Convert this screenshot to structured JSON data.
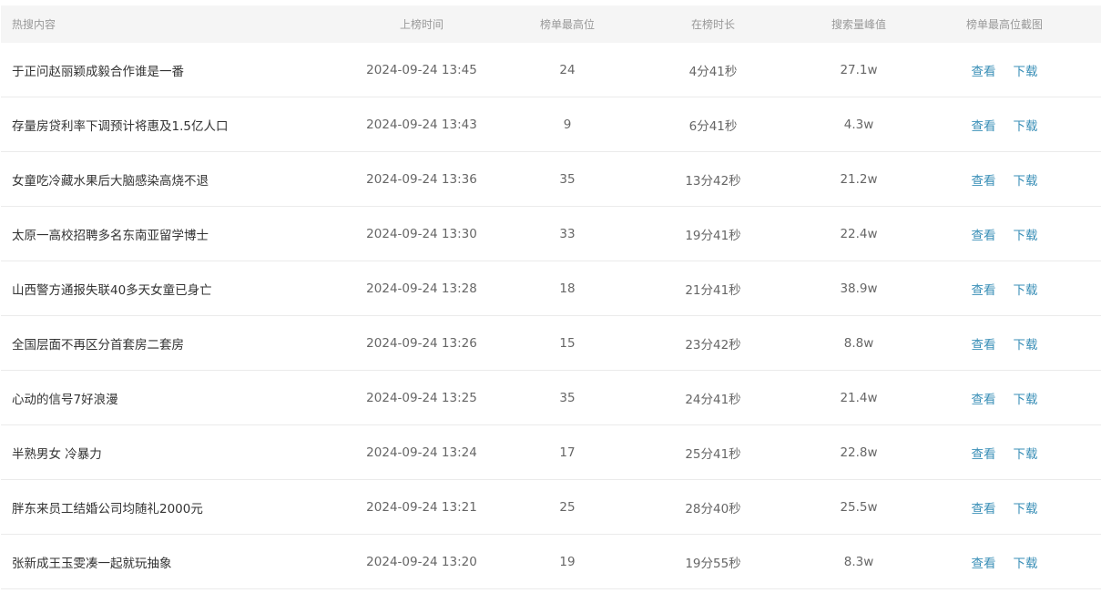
{
  "headers": {
    "title": "热搜内容",
    "time": "上榜时间",
    "rank": "榜单最高位",
    "duration": "在榜时长",
    "peak": "搜索量峰值",
    "screenshot": "榜单最高位截图"
  },
  "actions": {
    "view": "查看",
    "download": "下载"
  },
  "rows": [
    {
      "title": "于正问赵丽颖成毅合作谁是一番",
      "time": "2024-09-24 13:45",
      "rank": "24",
      "duration": "4分41秒",
      "peak": "27.1w"
    },
    {
      "title": "存量房贷利率下调预计将惠及1.5亿人口",
      "time": "2024-09-24 13:43",
      "rank": "9",
      "duration": "6分41秒",
      "peak": "4.3w"
    },
    {
      "title": "女童吃冷藏水果后大脑感染高烧不退",
      "time": "2024-09-24 13:36",
      "rank": "35",
      "duration": "13分42秒",
      "peak": "21.2w"
    },
    {
      "title": "太原一高校招聘多名东南亚留学博士",
      "time": "2024-09-24 13:30",
      "rank": "33",
      "duration": "19分41秒",
      "peak": "22.4w"
    },
    {
      "title": "山西警方通报失联40多天女童已身亡",
      "time": "2024-09-24 13:28",
      "rank": "18",
      "duration": "21分41秒",
      "peak": "38.9w"
    },
    {
      "title": "全国层面不再区分首套房二套房",
      "time": "2024-09-24 13:26",
      "rank": "15",
      "duration": "23分42秒",
      "peak": "8.8w"
    },
    {
      "title": "心动的信号7好浪漫",
      "time": "2024-09-24 13:25",
      "rank": "35",
      "duration": "24分41秒",
      "peak": "21.4w"
    },
    {
      "title": "半熟男女 冷暴力",
      "time": "2024-09-24 13:24",
      "rank": "17",
      "duration": "25分41秒",
      "peak": "22.8w"
    },
    {
      "title": "胖东来员工结婚公司均随礼2000元",
      "time": "2024-09-24 13:21",
      "rank": "25",
      "duration": "28分40秒",
      "peak": "25.5w"
    },
    {
      "title": "张新成王玉雯凑一起就玩抽象",
      "time": "2024-09-24 13:20",
      "rank": "19",
      "duration": "19分55秒",
      "peak": "8.3w"
    }
  ]
}
